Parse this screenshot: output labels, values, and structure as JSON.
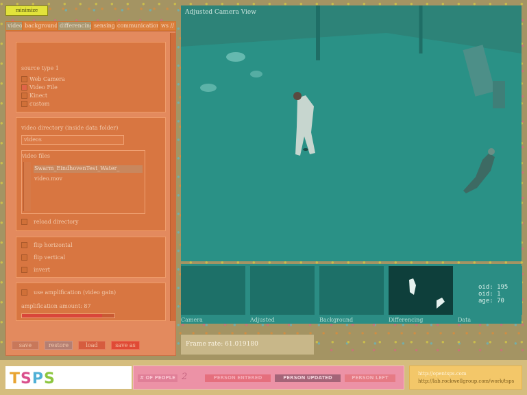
{
  "minimize_label": "minimize",
  "tabs": [
    {
      "label": "video"
    },
    {
      "label": "background"
    },
    {
      "label": "differencing"
    },
    {
      "label": "sensing"
    },
    {
      "label": "communication"
    },
    {
      "label": "ws //"
    }
  ],
  "source": {
    "title": "source type 1",
    "options": [
      {
        "label": "Web Camera",
        "checked": false
      },
      {
        "label": "Video File",
        "checked": true
      },
      {
        "label": "Kinect",
        "checked": false
      },
      {
        "label": "custom",
        "checked": false
      }
    ]
  },
  "video": {
    "dir_label": "video directory (inside data folder)",
    "dir_value": "videos",
    "files_label": "video files",
    "files": [
      "Swarm_EindhovenTest_Water_",
      "video.mov"
    ],
    "reload_label": "reload directory"
  },
  "flip": {
    "horizontal": "flip horizontal",
    "vertical": "flip vertical",
    "invert": "invert"
  },
  "amplification": {
    "use_label": "use amplification (video gain)",
    "amount_label": "amplification amount: 87",
    "amount": 87
  },
  "buttons": {
    "save": "save",
    "restore": "restore",
    "load": "load",
    "save_as": "save as"
  },
  "camera_view_title": "Adjusted Camera View",
  "thumbnails": [
    "Camera",
    "Adjusted",
    "Background",
    "Differencing",
    "Data"
  ],
  "data_panel": [
    "oid: 195",
    "oid: 1",
    "age: 70"
  ],
  "frame_rate": "Frame rate: 61.019180",
  "logo_text": "TSPS",
  "people": {
    "label": "# OF PEOPLE",
    "count": "2",
    "entered": "PERSON ENTERED",
    "updated": "PERSON UPDATED",
    "left": "PERSON LEFT"
  },
  "links": [
    "http://opentsps.com",
    "http://lab.rockwellgroup.com/work/tsps"
  ],
  "colors": {
    "accent": "#e2e33b",
    "panel": "#e38a5e",
    "view": "#2a8f85",
    "pink": "#ec92a6",
    "yellow": "#f3c769"
  }
}
